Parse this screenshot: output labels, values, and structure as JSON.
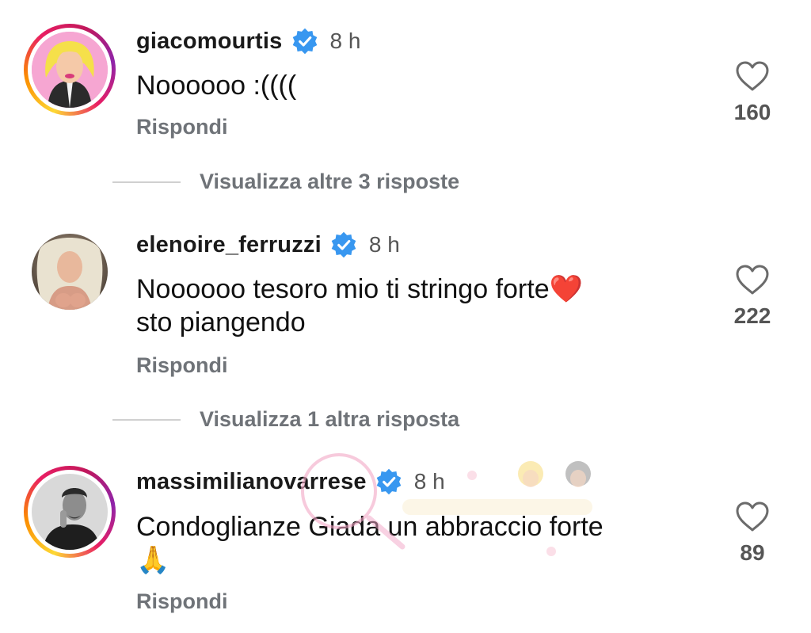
{
  "comments": [
    {
      "username": "giacomourtis",
      "time": "8 h",
      "text": "Noooooo :((((",
      "reply_label": "Rispondi",
      "likes": "160",
      "has_story_ring": true
    },
    {
      "username": "elenoire_ferruzzi",
      "time": "8 h",
      "text_line1": "Noooooo tesoro mio ti stringo forte❤️",
      "text_line2": "sto piangendo",
      "reply_label": "Rispondi",
      "likes": "222",
      "has_story_ring": false
    },
    {
      "username": "massimilianovarrese",
      "time": "8 h",
      "text_line1": "Condoglianze Giada un abbraccio forte",
      "text_line2": "🙏",
      "reply_label": "Rispondi",
      "likes": "89",
      "has_story_ring": true
    }
  ],
  "view_more": [
    {
      "label": "Visualizza altre 3 risposte"
    },
    {
      "label": "Visualizza 1 altra risposta"
    }
  ],
  "icons": {
    "verified": "verified-badge-icon",
    "like": "heart-outline-icon"
  },
  "colors": {
    "verified_blue": "#3897f0",
    "secondary_text": "#6f7378"
  }
}
